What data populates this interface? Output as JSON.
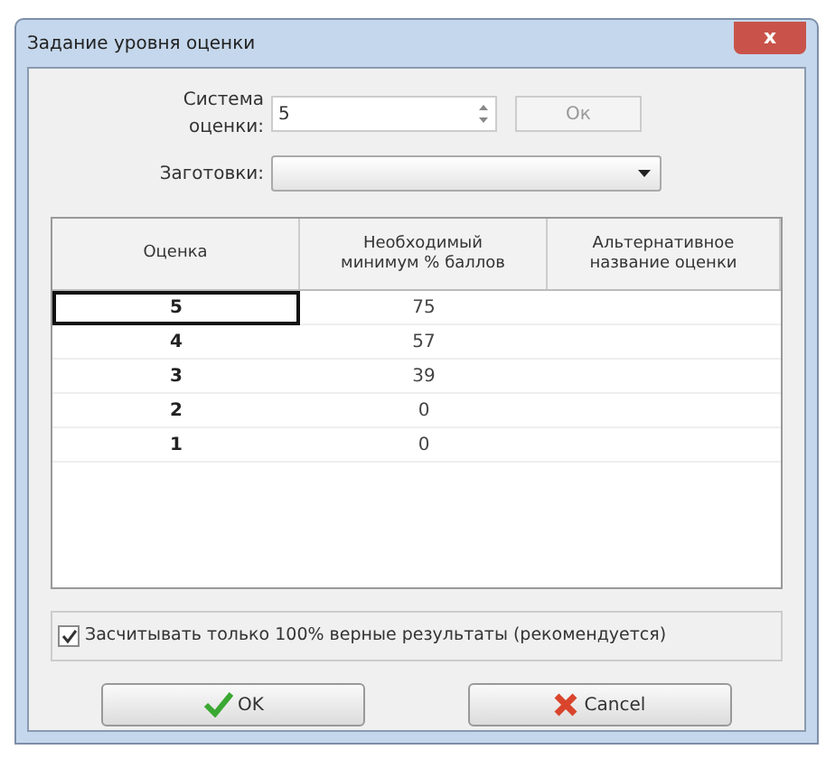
{
  "window": {
    "title": "Задание уровня оценки",
    "close": "x"
  },
  "grading_system": {
    "label": "Система оценки:",
    "value": "5",
    "ok_button": "Ок"
  },
  "presets": {
    "label": "Заготовки:"
  },
  "table": {
    "columns": [
      "Оценка",
      "Необходимый минимум % баллов",
      "Альтернативное название оценки"
    ],
    "rows": [
      {
        "grade": "5",
        "min": "75",
        "selected": true
      },
      {
        "grade": "4",
        "min": "57",
        "selected": false
      },
      {
        "grade": "3",
        "min": "39",
        "selected": false
      },
      {
        "grade": "2",
        "min": "0",
        "selected": false
      },
      {
        "grade": "1",
        "min": "0",
        "selected": false
      }
    ]
  },
  "checkbox": {
    "label": "Засчитывать только 100% верные результаты (рекомендуется)",
    "checked": true
  },
  "buttons": [
    {
      "label": "OK",
      "kind": "ok"
    },
    {
      "label": "Cancel",
      "kind": "cancel"
    }
  ]
}
